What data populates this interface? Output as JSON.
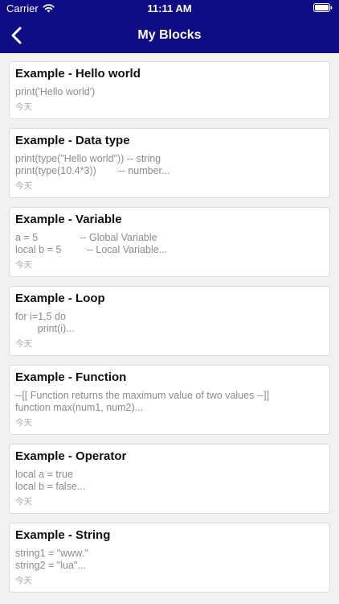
{
  "status_bar": {
    "carrier": "Carrier",
    "time": "11:11 AM"
  },
  "nav": {
    "title": "My Blocks"
  },
  "colors": {
    "nav_background": "#0e0d86",
    "page_background": "#f1f1f1"
  },
  "blocks": [
    {
      "title": "Example - Hello world",
      "code": "print('Hello world')",
      "date": "今天"
    },
    {
      "title": "Example - Data type",
      "code": "print(type(\"Hello world\")) -- string\nprint(type(10.4*3))        -- number...",
      "date": "今天"
    },
    {
      "title": "Example - Variable",
      "code": "a = 5               -- Global Variable\nlocal b = 5         -- Local Variable...",
      "date": "今天"
    },
    {
      "title": "Example - Loop",
      "code": "for i=1,5 do\n        print(i)...",
      "date": "今天"
    },
    {
      "title": "Example - Function",
      "code": "--[[ Function returns the maximum value of two values --]]\nfunction max(num1, num2)...",
      "date": "今天"
    },
    {
      "title": "Example - Operator",
      "code": "local a = true\nlocal b = false...",
      "date": "今天"
    },
    {
      "title": "Example - String",
      "code": "string1 = \"www.\"\nstring2 = \"lua\"...",
      "date": "今天"
    }
  ]
}
